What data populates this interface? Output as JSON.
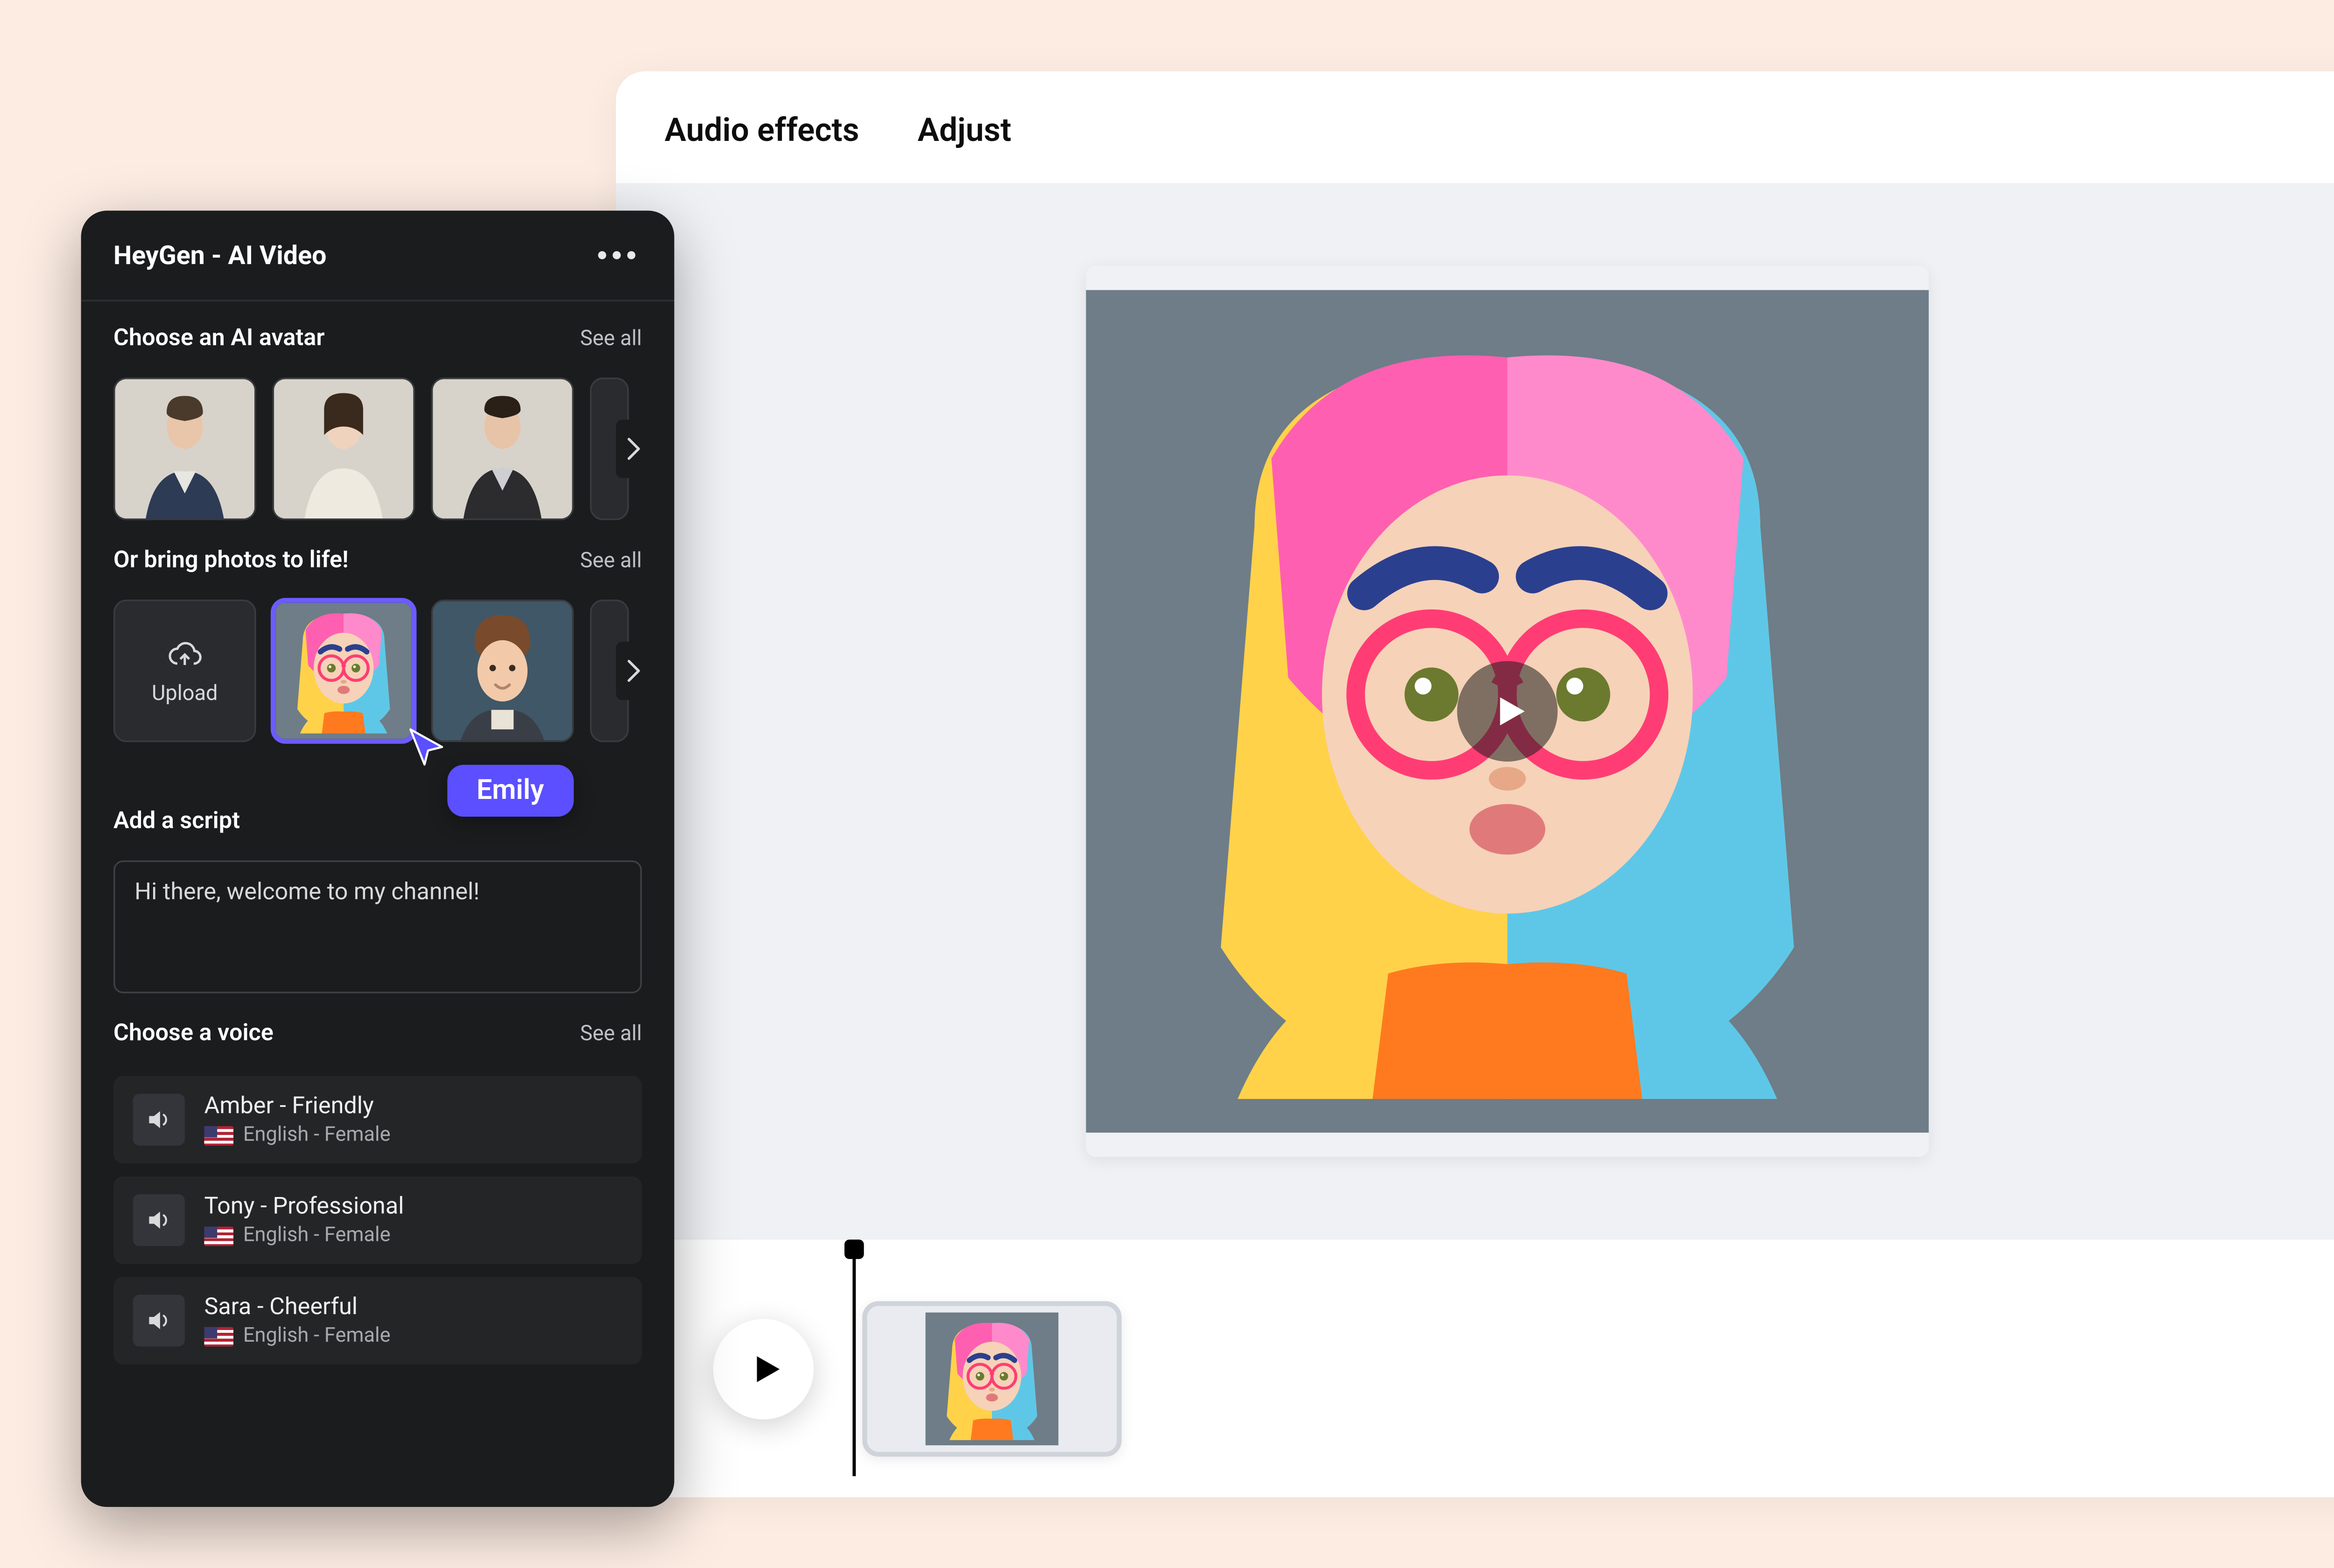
{
  "editor": {
    "tabs": {
      "audio_effects": "Audio effects",
      "adjust": "Adjust"
    }
  },
  "panel": {
    "title": "HeyGen - AI Video",
    "avatars": {
      "heading": "Choose an AI avatar",
      "see_all": "See all"
    },
    "photos": {
      "heading": "Or bring photos to life!",
      "see_all": "See all",
      "upload_label": "Upload",
      "cursor_label": "Emily"
    },
    "script": {
      "label": "Add a script",
      "value": "Hi there, welcome to my channel!"
    },
    "voices": {
      "heading": "Choose a voice",
      "see_all": "See all",
      "items": [
        {
          "name": "Amber - Friendly",
          "lang": "English - Female"
        },
        {
          "name": "Tony - Professional",
          "lang": "English - Female"
        },
        {
          "name": "Sara - Cheerful",
          "lang": "English - Female"
        }
      ]
    }
  }
}
